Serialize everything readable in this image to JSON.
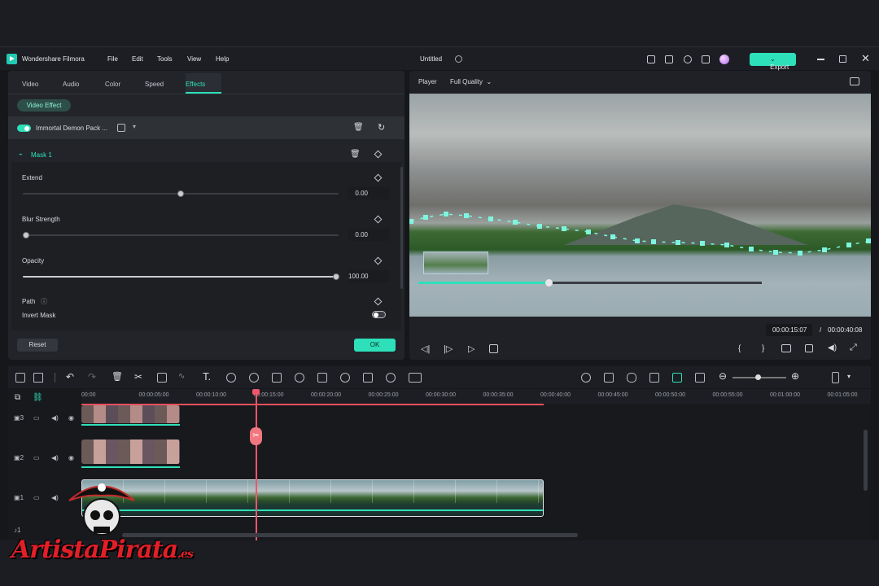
{
  "app": {
    "name": "Wondershare Filmora",
    "project": "Untitled",
    "export_label": "Export"
  },
  "menu": [
    "File",
    "Edit",
    "Tools",
    "View",
    "Help"
  ],
  "tabs": [
    "Video",
    "Audio",
    "Color",
    "Speed",
    "Effects"
  ],
  "active_tab": "Effects",
  "effect_panel": {
    "section_pill": "Video Effect",
    "effect_name": "Immortal Demon Pack ...",
    "mask_label": "Mask 1",
    "params": [
      {
        "label": "Extend",
        "value": "0.00",
        "level": 0.5
      },
      {
        "label": "Blur Strength",
        "value": "0.00",
        "level": 0.0
      },
      {
        "label": "Opacity",
        "value": "100.00",
        "level": 1.0
      }
    ],
    "path_label": "Path",
    "invert_label": "Invert Mask",
    "reset_label": "Reset",
    "ok_label": "OK"
  },
  "player": {
    "label": "Player",
    "quality": "Full Quality",
    "current_time": "00:00:15:07",
    "separator": "/",
    "total_time": "00:00:40:08",
    "progress": 0.38
  },
  "timeline": {
    "ruler": [
      "00:00",
      "00:00:05:00",
      "00:00:10:00",
      "00:00:15:00",
      "00:00:20:00",
      "00:00:25:00",
      "00:00:30:00",
      "00:00:35:00",
      "00:00:40:00",
      "00:00:45:00",
      "00:00:50:00",
      "00:00:55:00",
      "00:01:00:00",
      "00:01:05:00"
    ],
    "tracks": [
      "3",
      "2",
      "1",
      "1"
    ]
  },
  "watermark": {
    "brand": "ArtistaPirata",
    "suffix": ".es"
  },
  "colors": {
    "accent": "#2ee0b9",
    "playhead": "#f0566a",
    "panel": "#222429",
    "background": "#15171b"
  }
}
